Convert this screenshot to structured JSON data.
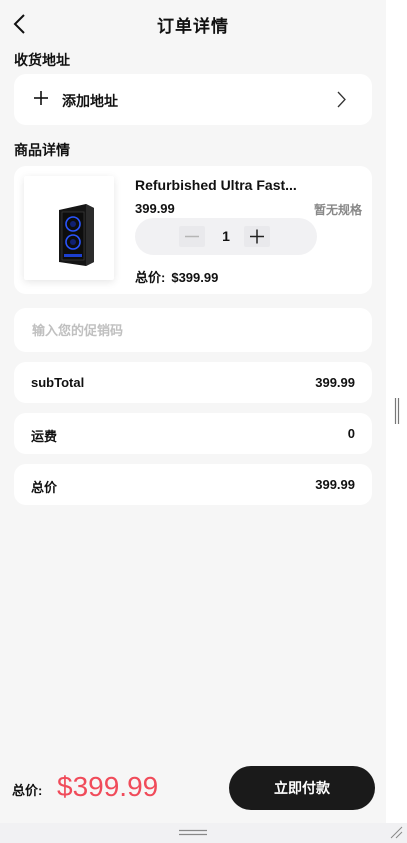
{
  "header": {
    "title": "订单详情"
  },
  "address_section": {
    "label": "收货地址",
    "add_label": "添加地址"
  },
  "product_section": {
    "label": "商品详情",
    "product": {
      "name": "Refurbished Ultra Fast...",
      "price": "399.99",
      "spec": "暂无规格",
      "quantity": "1",
      "total_label": "总价:",
      "total_value": "$399.99"
    }
  },
  "promo": {
    "placeholder": "输入您的促销码"
  },
  "summary": [
    {
      "label": "subTotal",
      "value": "399.99"
    },
    {
      "label": "运费",
      "value": "0"
    },
    {
      "label": "总价",
      "value": "399.99"
    }
  ],
  "footer": {
    "total_label": "总价:",
    "total_price": "$399.99",
    "pay_button": "立即付款"
  },
  "colors": {
    "accent_price": "#f04b5a",
    "button_bg": "#1a1a1a",
    "page_bg": "#f6f6f6",
    "card_bg": "#ffffff"
  }
}
